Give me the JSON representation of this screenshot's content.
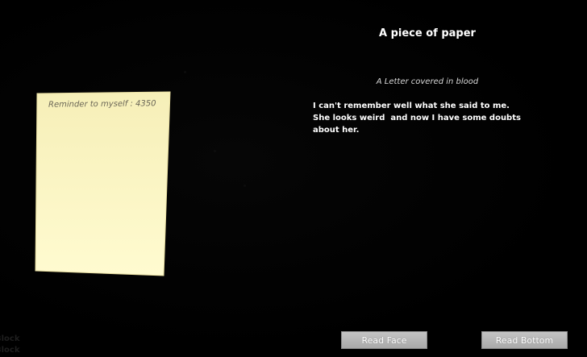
{
  "item": {
    "title": "A piece of paper",
    "subtitle": "A Letter covered in blood",
    "description": "I can't remember well what she said to me. She looks weird  and now I have some doubts  about her."
  },
  "paper": {
    "note": "Reminder to myself : 4350",
    "color": "#fdf8c4"
  },
  "buttons": {
    "read_face": "Read Face",
    "read_bottom": "Read Bottom"
  },
  "hud": {
    "line_1": "Block",
    "line_2": "Block"
  }
}
